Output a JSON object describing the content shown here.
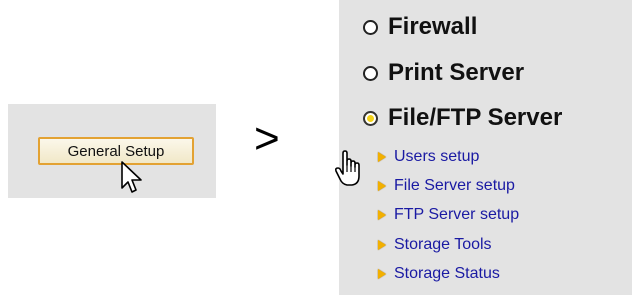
{
  "left": {
    "button_label": "General Setup"
  },
  "separator": ">",
  "menu": {
    "items": [
      {
        "label": "Firewall",
        "active": false
      },
      {
        "label": "Print Server",
        "active": false
      },
      {
        "label": "File/FTP Server",
        "active": true
      }
    ],
    "subitems": [
      {
        "label": "Users setup"
      },
      {
        "label": "File Server setup"
      },
      {
        "label": "FTP Server setup"
      },
      {
        "label": "Storage Tools"
      },
      {
        "label": "Storage Status"
      }
    ]
  },
  "colors": {
    "panel_bg": "#e3e3e3",
    "button_border": "#e3a233",
    "link": "#1a1aa3",
    "bullet": "#f2b000",
    "active_radio": "#f3d21a"
  }
}
